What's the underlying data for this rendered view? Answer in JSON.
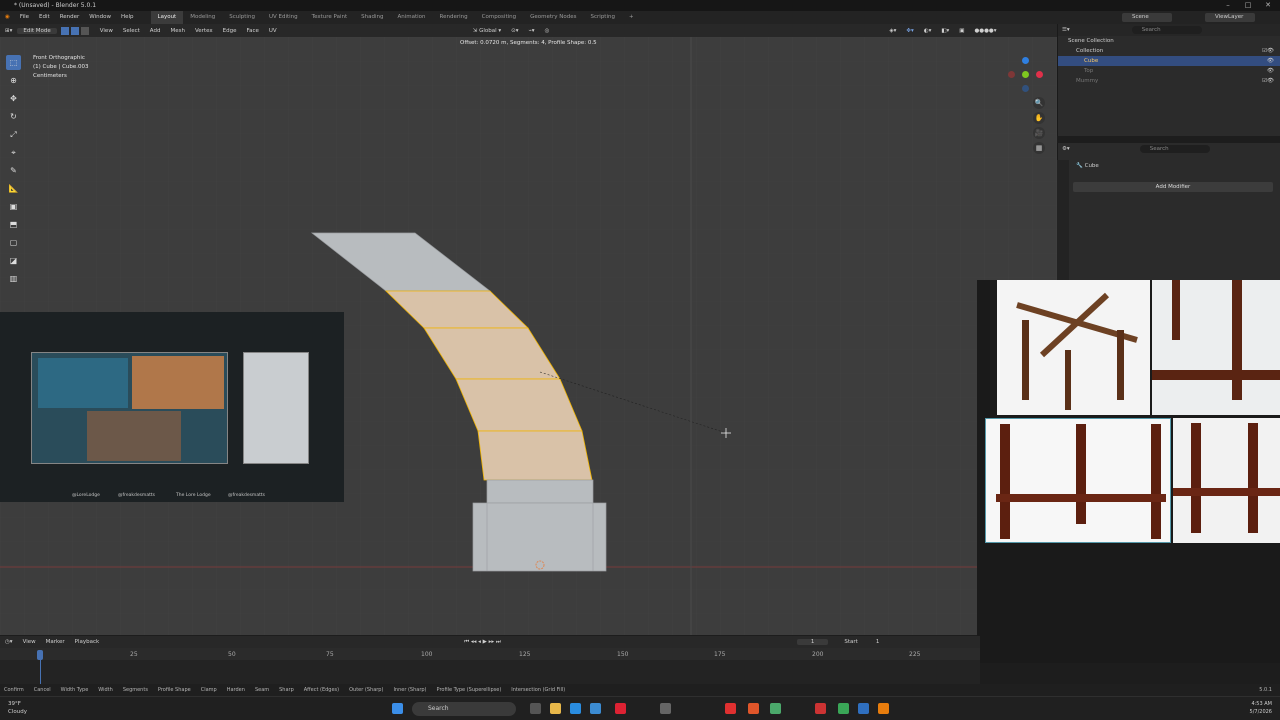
{
  "title_bar": {
    "title": "* (Unsaved) - Blender 5.0.1"
  },
  "menus": [
    "File",
    "Edit",
    "Render",
    "Window",
    "Help"
  ],
  "workspaces": [
    {
      "label": "Layout",
      "active": true
    },
    {
      "label": "Modeling"
    },
    {
      "label": "Sculpting"
    },
    {
      "label": "UV Editing"
    },
    {
      "label": "Texture Paint"
    },
    {
      "label": "Shading"
    },
    {
      "label": "Animation"
    },
    {
      "label": "Rendering"
    },
    {
      "label": "Compositing"
    },
    {
      "label": "Geometry Nodes"
    },
    {
      "label": "Scripting"
    }
  ],
  "scene": {
    "name": "Scene",
    "view_layer": "ViewLayer"
  },
  "header3d": {
    "mode": "Edit Mode",
    "menus": [
      "View",
      "Select",
      "Add",
      "Mesh",
      "Vertex",
      "Edge",
      "Face",
      "UV"
    ],
    "transform_orientation": "Global"
  },
  "viewport": {
    "operator_hint": "Offset: 0.0720 m, Segments: 4, Profile Shape: 0.5",
    "view_name": "Front Orthographic",
    "object_info": "(1) Cube | Cube.003",
    "units": "Centimeters"
  },
  "outliner": {
    "search_placeholder": "Search",
    "items": [
      {
        "label": "Scene Collection",
        "indent": 0
      },
      {
        "label": "Collection",
        "indent": 1
      },
      {
        "label": "Cube",
        "indent": 2,
        "selected": true
      },
      {
        "label": "Top",
        "indent": 2
      },
      {
        "label": "Mummy",
        "indent": 1
      }
    ]
  },
  "properties": {
    "search_placeholder": "Search",
    "object_name": "Cube",
    "add_modifier": "Add Modifier"
  },
  "timeline": {
    "menus": [
      "View",
      "Marker",
      "Playback"
    ],
    "current_frame": "1",
    "start_label": "Start",
    "start_value": "1",
    "ticks": [
      "1",
      "25",
      "50",
      "75",
      "100",
      "125",
      "150",
      "175",
      "200",
      "225"
    ]
  },
  "status_bar": {
    "items": [
      "Confirm",
      "Cancel",
      "Width Type",
      "Width",
      "Segments",
      "Profile Shape",
      "Clamp",
      "Harden",
      "Seam",
      "Sharp",
      "Affect (Edges)",
      "Outer (Sharp)",
      "Inner (Sharp)",
      "Profile Type (Superellipse)",
      "Intersection (Grid Fill)"
    ],
    "version": "5.0.1"
  },
  "stream_overlay": {
    "socials": [
      "@LoreLodge",
      "@freakdesmatts",
      "The Lore Lodge",
      "@freakdesmatts"
    ]
  },
  "taskbar": {
    "weather_temp": "39°F",
    "weather_desc": "Cloudy",
    "search_placeholder": "Search",
    "time": "4:53 AM",
    "date": "5/7/2026"
  },
  "colors": {
    "accent": "#4772b3",
    "viewport_bg": "#3d3d3d",
    "selected_face": "#d9c2a8",
    "edge_highlight": "#f0b400"
  }
}
